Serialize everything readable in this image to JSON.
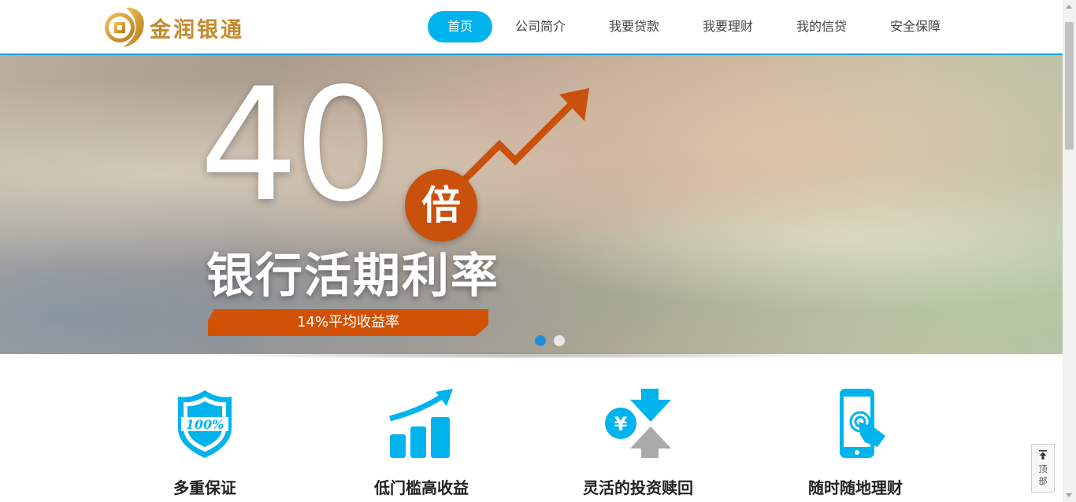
{
  "header": {
    "logo_text": "金润银通",
    "nav": [
      {
        "label": "首页",
        "active": true
      },
      {
        "label": "公司简介",
        "active": false
      },
      {
        "label": "我要贷款",
        "active": false
      },
      {
        "label": "我要理财",
        "active": false
      },
      {
        "label": "我的信贷",
        "active": false
      },
      {
        "label": "安全保障",
        "active": false
      }
    ]
  },
  "banner": {
    "big_number": "40",
    "multiplier": "倍",
    "subtitle": "银行活期利率",
    "ribbon_text": "14%平均收益率",
    "slide_count": 2,
    "active_slide": 1,
    "accent_color": "#c9510b"
  },
  "features": [
    {
      "icon": "shield-100-icon",
      "title": "多重保证"
    },
    {
      "icon": "bar-chart-growth-icon",
      "title": "低门槛高收益"
    },
    {
      "icon": "yuan-exchange-icon",
      "title": "灵活的投资赎回"
    },
    {
      "icon": "mobile-touch-icon",
      "title": "随时随地理财"
    }
  ],
  "shield_badge": "100%",
  "exchange_symbol": "¥",
  "back_to_top": {
    "line1": "顶",
    "line2": "部"
  },
  "colors": {
    "nav_active": "#00b3ec",
    "icon_blue": "#00b3ec",
    "header_line": "#1f9ddb",
    "logo_gold": "#c48a2b"
  }
}
